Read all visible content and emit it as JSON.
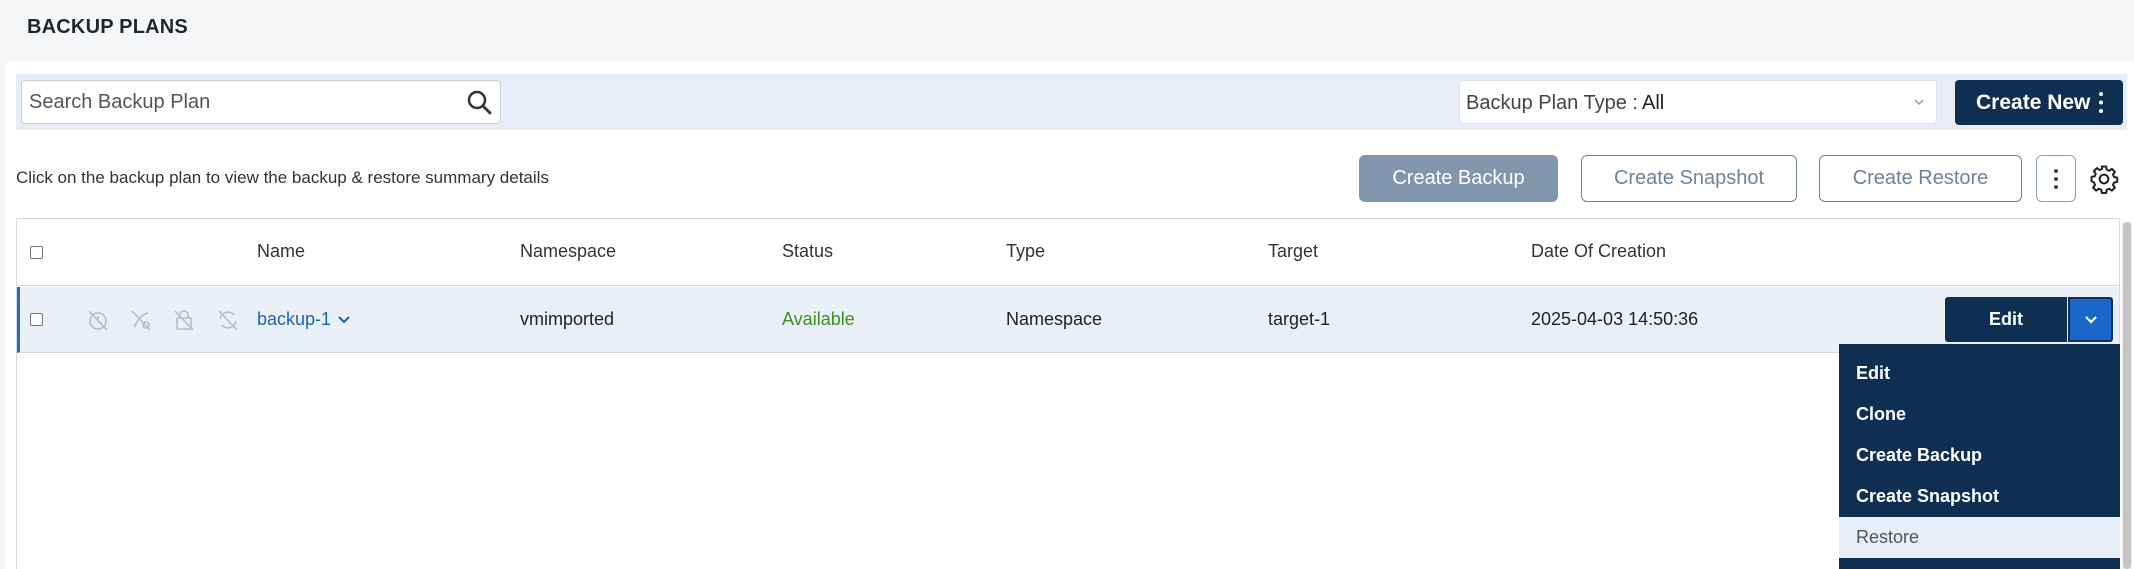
{
  "page": {
    "title": "BACKUP PLANS"
  },
  "search": {
    "placeholder": "Search Backup Plan",
    "value": ""
  },
  "filter": {
    "label": "Backup Plan Type :",
    "value": "All"
  },
  "toolbar": {
    "create_new_label": "Create New"
  },
  "hint": "Click on the backup plan to view the backup & restore summary details",
  "actions": {
    "create_backup": "Create Backup",
    "create_snapshot": "Create Snapshot",
    "create_restore": "Create Restore"
  },
  "table": {
    "columns": [
      "Name",
      "Namespace",
      "Status",
      "Type",
      "Target",
      "Date Of Creation"
    ],
    "rows": [
      {
        "name": "backup-1",
        "namespace": "vmimported",
        "status": "Available",
        "type": "Namespace",
        "target": "target-1",
        "created": "2025-04-03 14:50:36"
      }
    ]
  },
  "row_actions": {
    "edit_label": "Edit",
    "menu": [
      "Edit",
      "Clone",
      "Create Backup",
      "Create Snapshot",
      "Restore"
    ]
  },
  "colors": {
    "primary": "#0e2f52",
    "accent": "#1a66c9",
    "status_available": "#3f8f1c",
    "link": "#1f63b0"
  },
  "icons": {
    "row_state_icons": [
      "schedule-disabled-icon",
      "retention-disabled-icon",
      "lock-disabled-icon",
      "sync-disabled-icon"
    ]
  }
}
